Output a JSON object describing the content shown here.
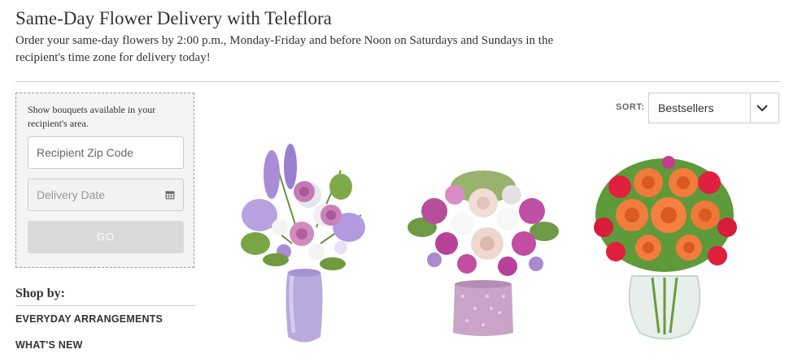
{
  "header": {
    "title": "Same-Day Flower Delivery with Teleflora",
    "subtitle": "Order your same-day flowers by 2:00 p.m., Monday-Friday and before Noon on Saturdays and Sundays in the recipient's time zone for delivery today!"
  },
  "filter": {
    "intro": "Show bouquets available in your recipient's area.",
    "zip_placeholder": "Recipient Zip Code",
    "date_placeholder": "Delivery Date",
    "go_label": "GO",
    "calendar_icon": "calendar-icon"
  },
  "shop_by": {
    "title": "Shop by:",
    "items": [
      {
        "label": "EVERYDAY ARRANGEMENTS"
      },
      {
        "label": "WHAT'S NEW"
      }
    ]
  },
  "sort": {
    "label": "SORT:",
    "selected": "Bestsellers",
    "chevron_icon": "chevron-down-icon"
  },
  "products": [
    {
      "image": "lavender-rose-bouquet-in-frosted-purple-vase"
    },
    {
      "image": "pink-rose-lily-bouquet-in-sparkle-cube"
    },
    {
      "image": "orange-red-rose-bouquet-in-glass-vase"
    }
  ],
  "colors": {
    "text": "#333333",
    "divider": "#cccccc",
    "filter_bg": "#f4f4f4",
    "button_disabled": "#d9d9d9"
  }
}
